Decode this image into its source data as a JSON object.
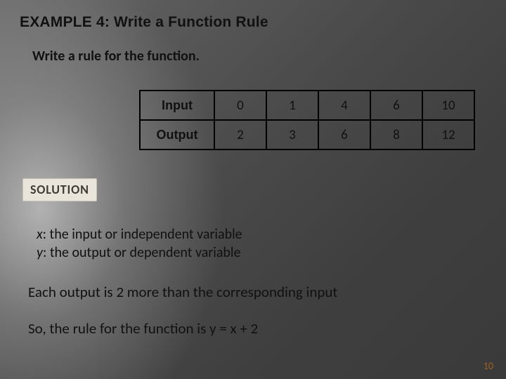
{
  "title": "EXAMPLE 4: Write a Function Rule",
  "prompt": "Write a rule for the function.",
  "table": {
    "rows": [
      {
        "label": "Input",
        "values": [
          "0",
          "1",
          "4",
          "6",
          "10"
        ]
      },
      {
        "label": "Output",
        "values": [
          "2",
          "3",
          "6",
          "8",
          "12"
        ]
      }
    ]
  },
  "solution_label": "SOLUTION",
  "defs": {
    "x_var": "x",
    "x_text": ": the input or independent variable",
    "y_var": "y",
    "y_text": ": the output or dependent variable"
  },
  "line1": "Each output is 2 more than the corresponding input",
  "line2": "So, the rule for the function is y =  x + 2",
  "page_number": "10"
}
